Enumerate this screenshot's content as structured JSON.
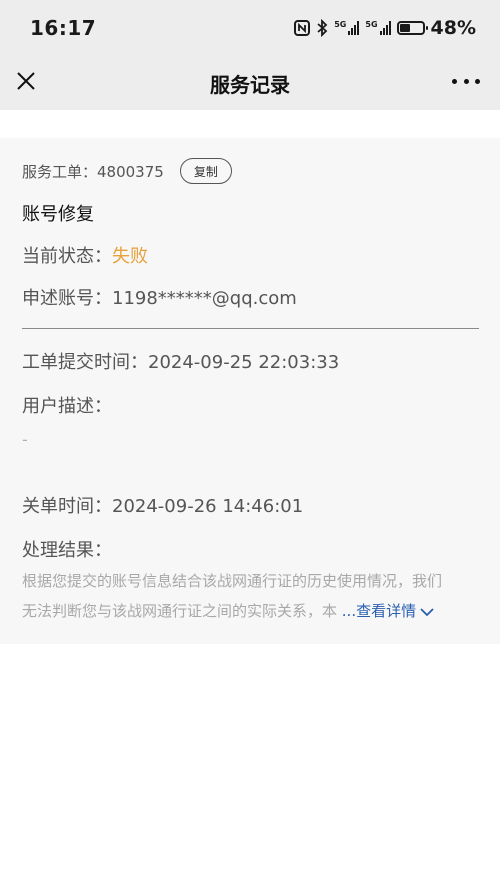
{
  "status_bar": {
    "time": "16:17",
    "icons": [
      "nfc-icon",
      "bluetooth-icon",
      "signal-5g-icon",
      "signal-5g-icon",
      "battery-icon"
    ],
    "signal_label_1": "5G",
    "signal_label_2": "5G",
    "battery_percent": "48%",
    "battery_level": 0.48
  },
  "nav": {
    "title": "服务记录",
    "close_icon": "close-icon",
    "more_icon": "more-icon"
  },
  "ticket": {
    "order_text": "服务工单：4800375",
    "copy_label": "复制",
    "issue_title": "账号修复",
    "status_label": "当前状态：",
    "status_value": "失败",
    "account_text": "申述账号：1198******@qq.com",
    "submit_time_text": "工单提交时间：2024-09-25 22:03:33",
    "desc_label": "用户描述：",
    "desc_value": "-",
    "close_time_text": "关单时间：2024-09-26 14:46:01",
    "result_label": "处理结果：",
    "result_line1": "根据您提交的账号信息结合该战网通行证的历史使用情况，我们",
    "result_line2": "无法判断您与该战网通行证之间的实际关系，本 ",
    "more_label": "...查看详情"
  },
  "colors": {
    "status_fail": "#e6a23c",
    "link": "#2a5fb0",
    "header_bg": "#ededed",
    "card_bg": "#f7f7f7"
  }
}
